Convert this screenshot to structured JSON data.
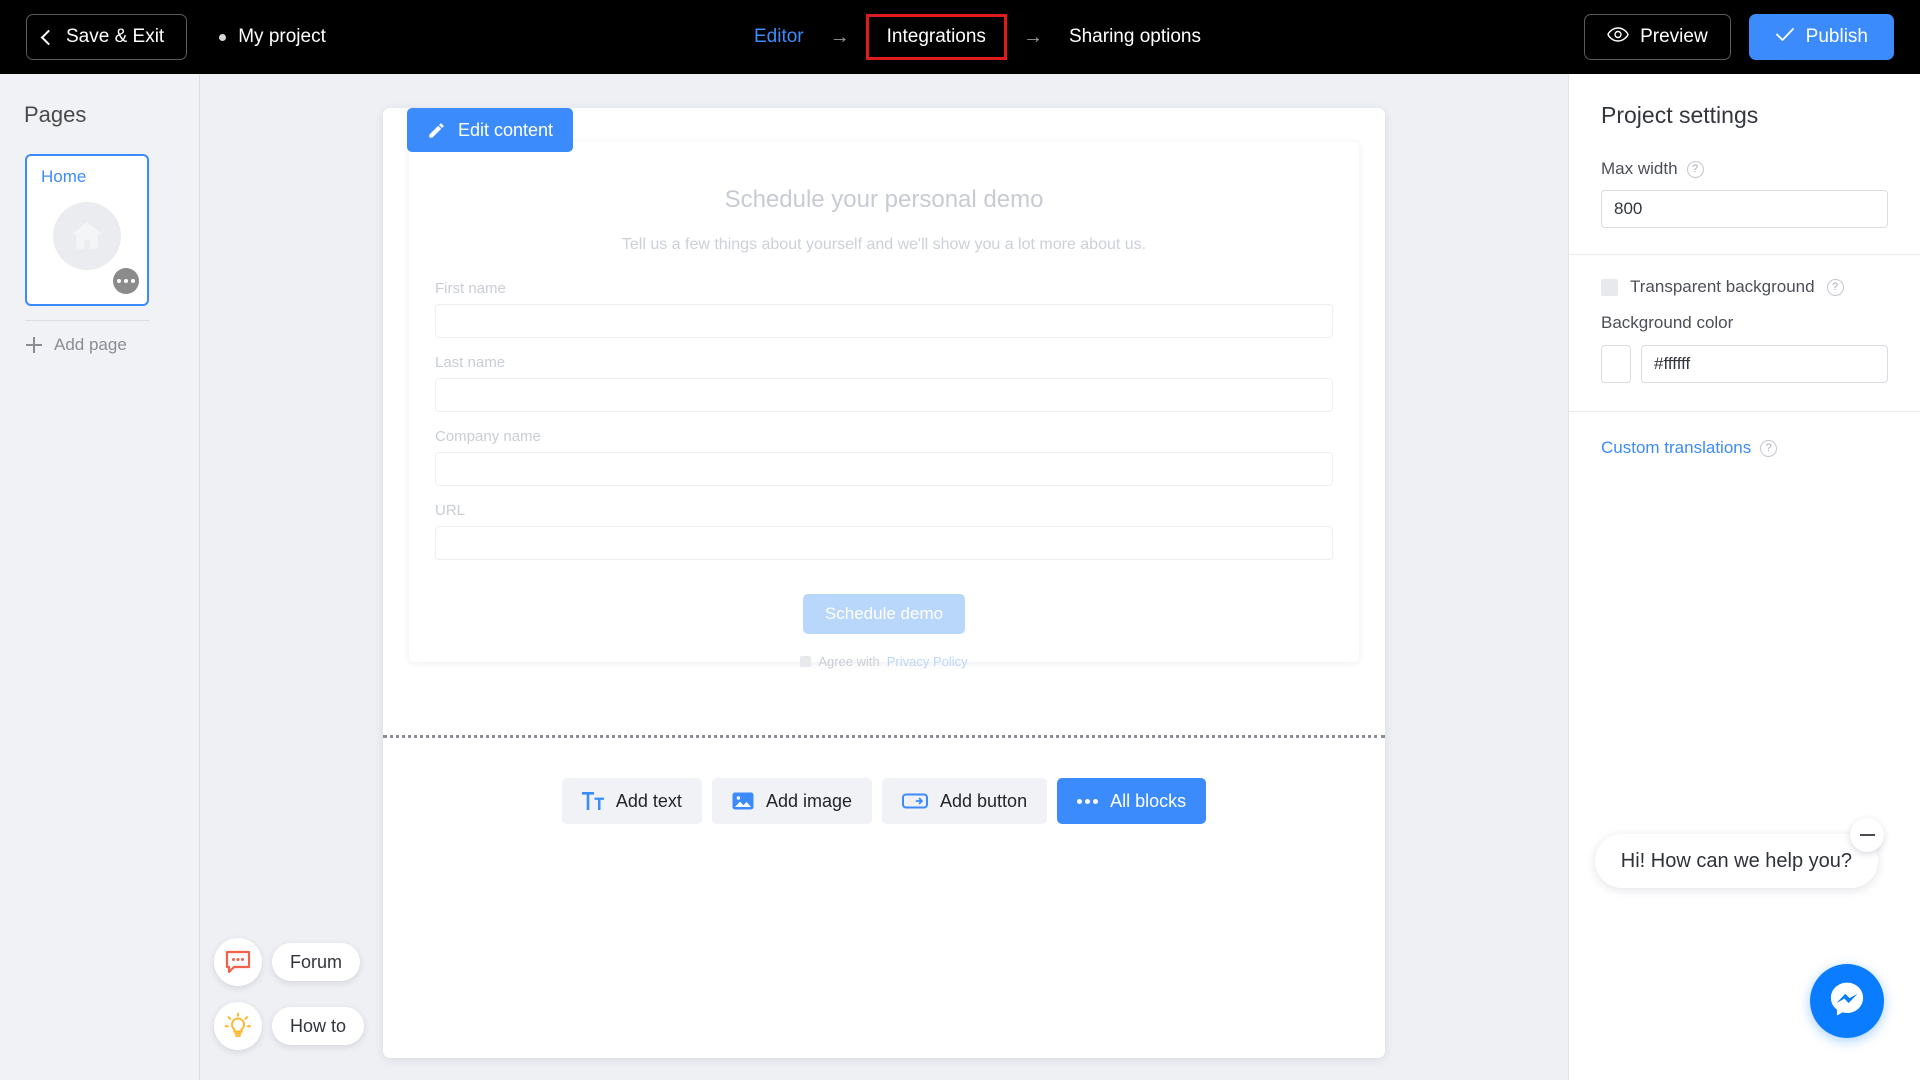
{
  "topbar": {
    "save_exit_label": "Save & Exit",
    "project_name": "My project",
    "nav": [
      {
        "label": "Editor",
        "state": "link"
      },
      {
        "label": "Integrations",
        "state": "highlighted"
      },
      {
        "label": "Sharing options",
        "state": "default"
      }
    ],
    "arrow_glyph": "→",
    "preview_label": "Preview",
    "publish_label": "Publish",
    "accent_color": "#3b8bfd",
    "highlight_box_color": "#e01b1b"
  },
  "sidebar": {
    "title": "Pages",
    "pages": [
      {
        "label": "Home",
        "selected": true
      }
    ],
    "add_page_label": "Add page"
  },
  "canvas": {
    "edit_content_label": "Edit content",
    "form": {
      "title": "Schedule your personal demo",
      "subtitle": "Tell us a few things about yourself and we'll show you a lot more about us.",
      "fields": [
        {
          "label": "First name",
          "value": "",
          "placeholder": ""
        },
        {
          "label": "Last name",
          "value": "",
          "placeholder": ""
        },
        {
          "label": "Company name",
          "value": "",
          "placeholder": ""
        },
        {
          "label": "URL",
          "value": "",
          "placeholder": ""
        }
      ],
      "submit_label": "Schedule demo",
      "agree_text": "Agree with",
      "privacy_link": "Privacy Policy"
    },
    "toolbar": [
      {
        "label": "Add text",
        "icon": "text-icon",
        "primary": false
      },
      {
        "label": "Add image",
        "icon": "image-icon",
        "primary": false
      },
      {
        "label": "Add button",
        "icon": "button-icon",
        "primary": false
      },
      {
        "label": "All blocks",
        "icon": "ellipsis-icon",
        "primary": true
      }
    ]
  },
  "help_widgets": [
    {
      "label": "Forum",
      "icon": "chat-bubble-icon",
      "color": "#f4604a"
    },
    {
      "label": "How to",
      "icon": "lightbulb-icon",
      "color": "#fbbráo"
    }
  ],
  "help_widgets_fixed": [
    {
      "label": "Forum"
    },
    {
      "label": "How to"
    }
  ],
  "right_panel": {
    "title": "Project settings",
    "max_width_label": "Max width",
    "max_width_value": "800",
    "transparent_bg_label": "Transparent background",
    "transparent_bg_checked": false,
    "background_color_label": "Background color",
    "background_color_value": "#ffffff",
    "custom_translations_label": "Custom translations",
    "help_glyph": "?"
  },
  "chat": {
    "greeting": "Hi! How can we help you?",
    "minimize_icon": "minimize-icon",
    "fab_icon": "messenger-icon",
    "fab_color": "#0a7cff"
  }
}
